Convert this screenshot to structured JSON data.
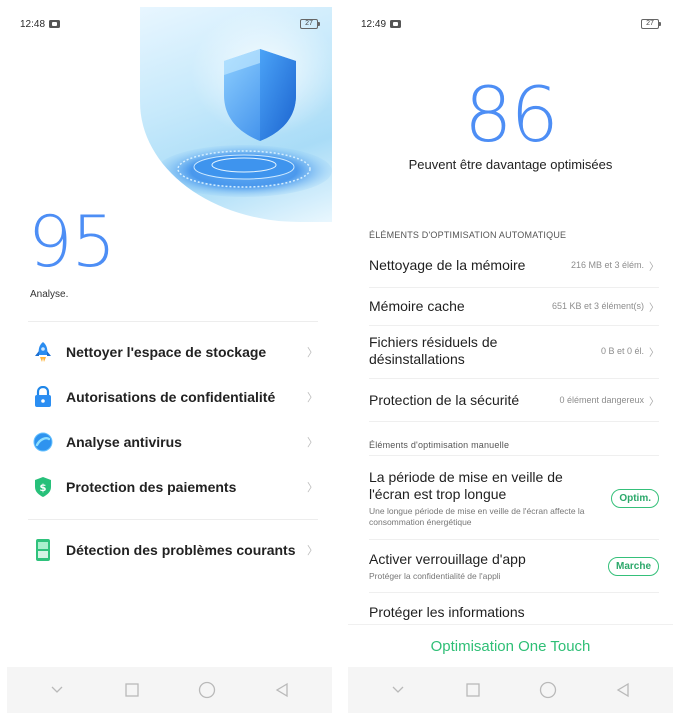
{
  "left": {
    "status": {
      "time": "12:48",
      "battery": "27"
    },
    "score": "95",
    "score_label": "Analyse.",
    "menu": [
      {
        "label": "Nettoyer l'espace de stockage",
        "icon": "rocket-icon"
      },
      {
        "label": "Autorisations de confidentialité",
        "icon": "lock-icon"
      },
      {
        "label": "Analyse antivirus",
        "icon": "antivirus-icon"
      },
      {
        "label": "Protection des paiements",
        "icon": "payment-shield-icon"
      },
      {
        "label": "Détection des problèmes courants",
        "icon": "phone-diagnostic-icon"
      }
    ]
  },
  "right": {
    "status": {
      "time": "12:49",
      "battery": "27"
    },
    "score": "86",
    "subtitle": "Peuvent être davantage optimisées",
    "auto_section": "ÉLÉMENTS D'OPTIMISATION AUTOMATIQUE",
    "auto_items": [
      {
        "title": "Nettoyage de la mémoire",
        "detail": "216 MB et 3 élém."
      },
      {
        "title": "Mémoire cache",
        "detail": "651 KB et 3 élément(s)"
      },
      {
        "title": "Fichiers résiduels de désinstallations",
        "detail": "0 B et 0 él."
      },
      {
        "title": "Protection de la sécurité",
        "detail": "0 élément dangereux"
      }
    ],
    "manual_section": "Éléments d'optimisation manuelle",
    "manual_items": [
      {
        "title": "La période de mise en veille de l'écran est trop longue",
        "desc": "Une longue période de mise en veille de l'écran affecte la consommation énergétique",
        "button": "Optim."
      },
      {
        "title": "Activer verrouillage d'app",
        "desc": "Protéger la confidentialité de l'appli",
        "button": "Marche"
      },
      {
        "title": "Protéger les informations",
        "desc": "",
        "button": ""
      }
    ],
    "cta": "Optimisation One Touch"
  },
  "colors": {
    "accent_blue": "#4d8ef5",
    "accent_green": "#2fbf76",
    "nav_bg": "#f5f5f5"
  }
}
